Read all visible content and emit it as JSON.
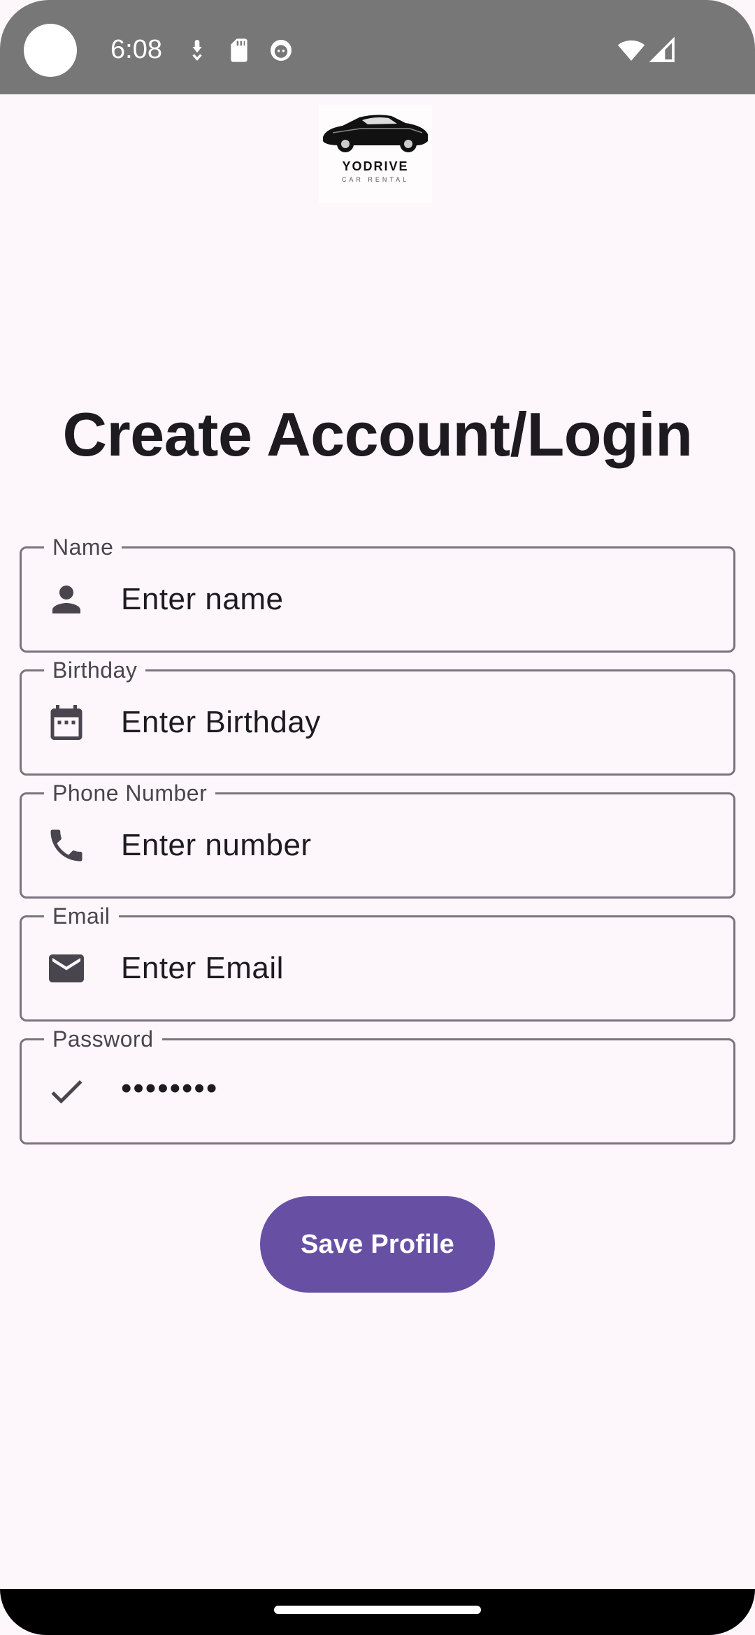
{
  "status_bar": {
    "time": "6:08",
    "icons": [
      "camera-dot",
      "download-icon",
      "sd-card-icon",
      "robot-face-icon",
      "wifi-icon",
      "signal-icon"
    ]
  },
  "logo": {
    "brand": "YODRIVE",
    "tagline": "CAR RENTAL"
  },
  "page": {
    "title": "Create Account/Login"
  },
  "form": {
    "name": {
      "label": "Name",
      "placeholder": "Enter name",
      "icon": "person-icon"
    },
    "birthday": {
      "label": "Birthday",
      "placeholder": "Enter Birthday",
      "icon": "calendar-icon"
    },
    "phone": {
      "label": "Phone Number",
      "placeholder": "Enter number",
      "icon": "phone-icon"
    },
    "email": {
      "label": "Email",
      "placeholder": "Enter Email",
      "icon": "mail-icon"
    },
    "password": {
      "label": "Password",
      "value": "••••••••",
      "icon": "check-icon"
    }
  },
  "actions": {
    "save_label": "Save Profile"
  },
  "colors": {
    "background": "#fdf7fb",
    "primary": "#6750a4",
    "outline": "#79747e",
    "status_bar": "#777777"
  }
}
